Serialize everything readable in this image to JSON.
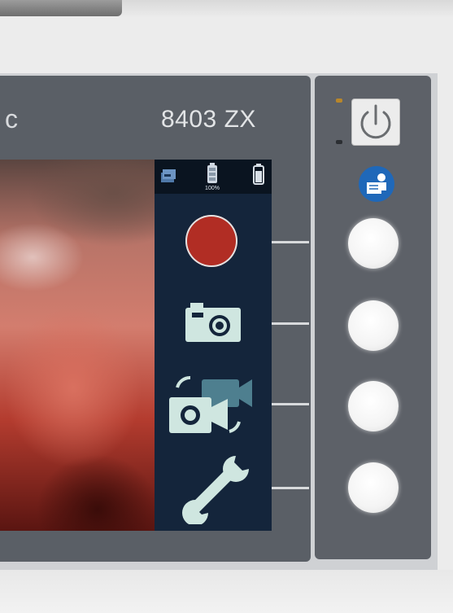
{
  "device": {
    "brand_partial": "c",
    "model": "8403 ZX"
  },
  "status_bar": {
    "icons": [
      "storage-icon",
      "battery-indicator-icon",
      "battery-icon"
    ],
    "battery_level": "100%"
  },
  "softkeys": [
    {
      "icon": "record-icon"
    },
    {
      "icon": "camera-icon"
    },
    {
      "icon": "switch-camera-mode-icon"
    },
    {
      "icon": "wrench-icon"
    }
  ],
  "control_panel": {
    "icons": [
      "power-icon",
      "help-manual-icon"
    ],
    "buttons": 4
  },
  "colors": {
    "record": "#b12d24",
    "panel_background": "#14253b",
    "icon_tint": "#cfe6e0",
    "help_button": "#1f68b9"
  }
}
